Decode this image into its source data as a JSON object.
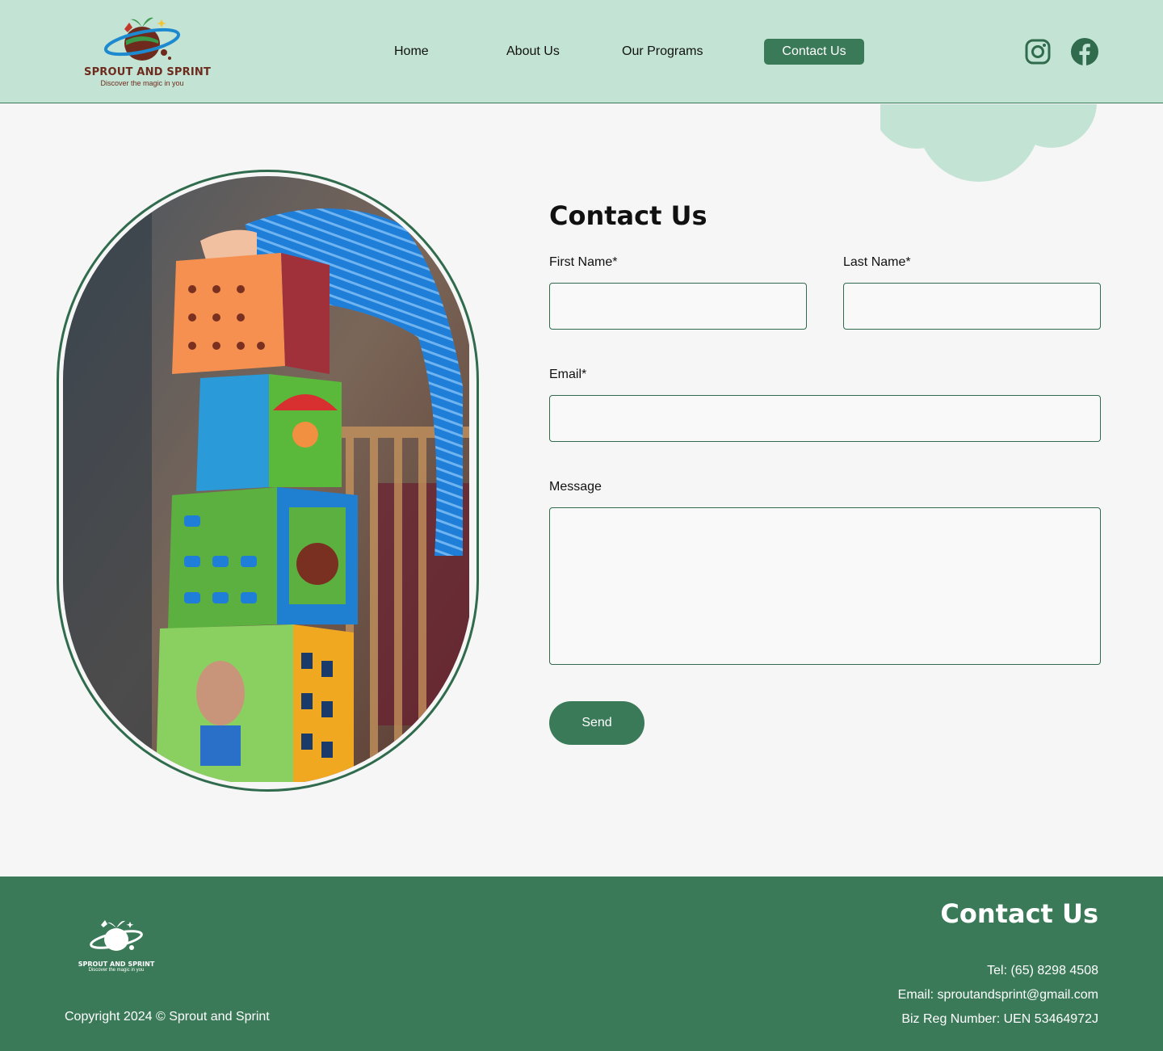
{
  "brand": {
    "name": "SPROUT AND SPRINT",
    "tagline": "Discover the magic in you"
  },
  "nav": {
    "items": [
      {
        "label": "Home"
      },
      {
        "label": "About Us"
      },
      {
        "label": "Our Programs"
      },
      {
        "label": "Contact Us",
        "active": true
      }
    ]
  },
  "social": [
    "instagram-icon",
    "facebook-icon"
  ],
  "form": {
    "title": "Contact Us",
    "first_name_label": "First Name*",
    "first_name_value": "",
    "last_name_label": "Last Name*",
    "last_name_value": "",
    "email_label": "Email*",
    "email_value": "",
    "message_label": "Message",
    "message_value": "",
    "send_label": "Send"
  },
  "footer": {
    "copyright": "Copyright 2024 © Sprout and Sprint",
    "contact_title": "Contact Us",
    "tel": "Tel: (65) 8298 4508",
    "email": "Email: sproutandsprint@gmail.com",
    "reg": "Biz Reg Number: UEN 53464972J"
  },
  "colors": {
    "header_bg": "#c3e4d4",
    "accent": "#3a7a58",
    "page_bg": "#f5f6f5",
    "brand_text": "#6e2b1d"
  }
}
